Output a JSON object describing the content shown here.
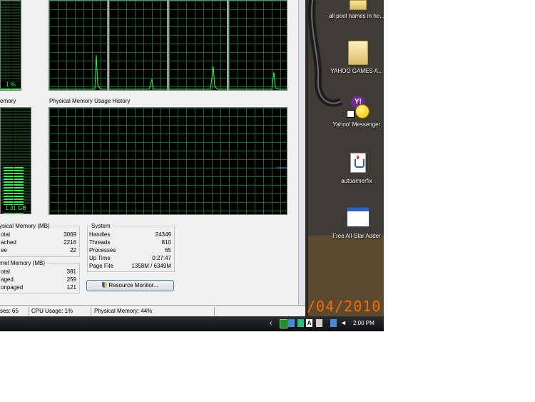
{
  "graphs": {
    "memory_section_label": "emory",
    "physical_history_title": "Physical Memory Usage History",
    "cpu_meter_value": "1 %",
    "memory_meter_value": "1.31 GB",
    "cpu_meter_level": 0.01,
    "memory_meter_level": 0.44
  },
  "physical_memory": {
    "title": "ysical Memory (MB)",
    "rows": [
      {
        "label": "otal",
        "value": "3069"
      },
      {
        "label": "ached",
        "value": "2216"
      },
      {
        "label": "ee",
        "value": "22"
      }
    ]
  },
  "kernel_memory": {
    "title": "rnel Memory (MB)",
    "rows": [
      {
        "label": "otal",
        "value": "381"
      },
      {
        "label": "aged",
        "value": "259"
      },
      {
        "label": "onpaged",
        "value": "121"
      }
    ]
  },
  "system": {
    "title": "System",
    "rows": [
      {
        "label": "Handles",
        "value": "24349"
      },
      {
        "label": "Threads",
        "value": "810"
      },
      {
        "label": "Processes",
        "value": "65"
      },
      {
        "label": "Up Time",
        "value": "0:27:47"
      },
      {
        "label": "Page File",
        "value": "1358M / 6349M"
      }
    ]
  },
  "resource_monitor_button": "Resource Monitor...",
  "status_bar": {
    "processes": "ses: 65",
    "cpu": "CPU Usage: 1%",
    "memory": "Physical Memory: 44%"
  },
  "desktop": {
    "icons": [
      {
        "label": "all pool names in he...",
        "icon": "folder-icon"
      },
      {
        "label": "YAHOO GAMES A...",
        "icon": "folder-icon"
      },
      {
        "label": "Yahoo! Messenger",
        "icon": "yahoo-messenger-icon"
      },
      {
        "label": "autoaimerfix",
        "icon": "java-file-icon"
      },
      {
        "label": "Free All-Star Adder",
        "icon": "application-window-icon"
      }
    ],
    "date_overlay": "/04/2010"
  },
  "taskbar": {
    "clock": "2:00 PM"
  },
  "colors": {
    "graph_green": "#22ff44",
    "grid_green": "#0a6b2f",
    "window_bg": "#f0f0f0",
    "date_overlay": "#ff6a00"
  }
}
